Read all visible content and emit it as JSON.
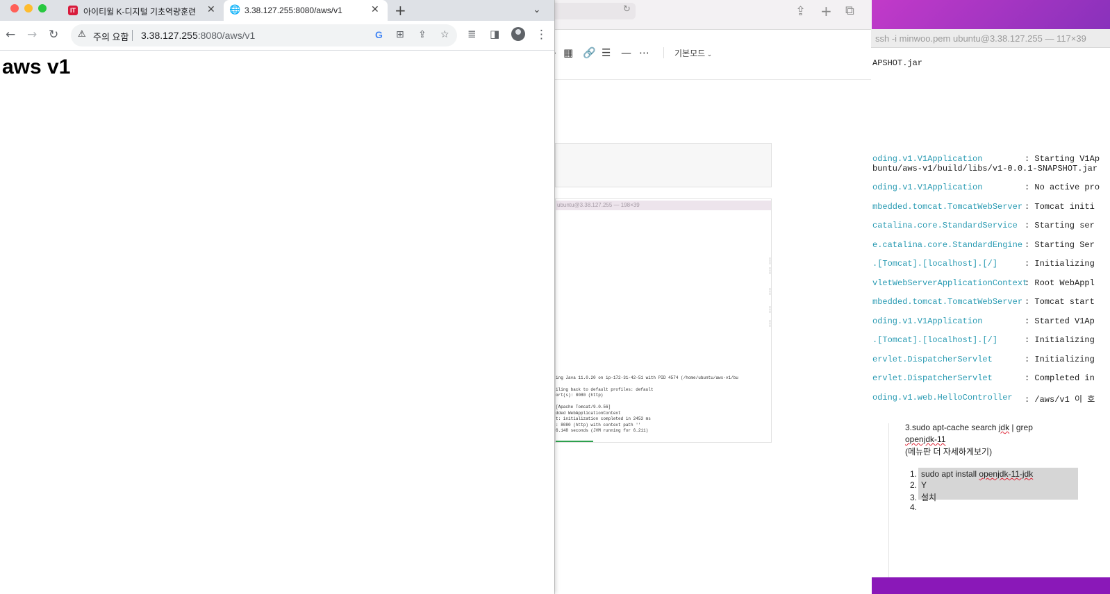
{
  "chrome": {
    "tabs": [
      {
        "label": "아이티윌 K-디지털 기초역량훈련 온라인",
        "favicon_text": "IT",
        "favicon_color": "#d81b3c"
      },
      {
        "label": "3.38.127.255:8080/aws/v1",
        "favicon_icon": "globe-icon"
      }
    ],
    "omnibox": {
      "security_label": "주의 요함",
      "url_host": "3.38.127.255",
      "url_path": ":8080/aws/v1"
    },
    "page": {
      "heading": "aws v1"
    }
  },
  "middle_window": {
    "editor_mode": "기본모드",
    "embedded_terminal_title": "ubuntu@3.38.127.255 — 198×39",
    "embedded_lines": [
      "ing Java 11.0.20 on ip-172-31-42-51 with PID 4574 (/home/ubuntu/aws-v1/bu",
      "iling back to default profiles: default",
      "ort(s): 8080 (http)",
      "",
      "[Apache Tomcat/9.0.56]",
      "dded WebApplicationContext",
      "t: initialization completed in 2453 ms",
      ": 8080 (http) with context path ''",
      "6.148 seconds (JVM running for 6.211)"
    ]
  },
  "terminal": {
    "title": "ssh -i minwoo.pem ubuntu@3.38.127.255 — 117×39",
    "first_line": "APSHOT.jar",
    "log_lines": [
      {
        "logger": "oding.v1.V1Application",
        "message": ": Starting V1Ap"
      },
      {
        "logger": "buntu/aws-v1/build/libs/v1-0.0.1-SNAPSHOT.jar",
        "message": ""
      },
      {
        "logger": "oding.v1.V1Application",
        "message": ": No active pro"
      },
      {
        "logger": "mbedded.tomcat.TomcatWebServer",
        "message": ": Tomcat initi"
      },
      {
        "logger": "catalina.core.StandardService",
        "message": ": Starting ser"
      },
      {
        "logger": "e.catalina.core.StandardEngine",
        "message": ": Starting Ser"
      },
      {
        "logger": ".[Tomcat].[localhost].[/]",
        "message": ": Initializing"
      },
      {
        "logger": "vletWebServerApplicationContext",
        "message": ": Root WebAppl"
      },
      {
        "logger": "mbedded.tomcat.TomcatWebServer",
        "message": ": Tomcat start"
      },
      {
        "logger": "oding.v1.V1Application",
        "message": ": Started V1Ap"
      },
      {
        "logger": ".[Tomcat].[localhost].[/]",
        "message": ": Initializing"
      },
      {
        "logger": "ervlet.DispatcherServlet",
        "message": ": Initializing"
      },
      {
        "logger": "ervlet.DispatcherServlet",
        "message": ": Completed in"
      },
      {
        "logger": "oding.v1.web.HelloController",
        "message": ": /aws/v1 이 호"
      }
    ]
  },
  "notes": {
    "line1_prefix": "3.sudo apt-cache search ",
    "line1_jdk": "jdk",
    "line1_suffix": " | grep",
    "line2": "openjdk-11",
    "line3": "(메뉴판 더 자세하게보기)",
    "list": [
      {
        "num": "1.",
        "prefix": "sudo apt install ",
        "squiggle": "openjdk-11-jdk"
      },
      {
        "num": "2.",
        "prefix": "Y",
        "squiggle": ""
      },
      {
        "num": "3.",
        "prefix": "설치",
        "squiggle": ""
      },
      {
        "num": "4.",
        "prefix": "",
        "squiggle": ""
      }
    ]
  },
  "colors": {
    "terminal_logger": "#2a9bb3",
    "wallpaper": "#9b30c0",
    "chrome_tabstrip": "#dee1e6"
  }
}
